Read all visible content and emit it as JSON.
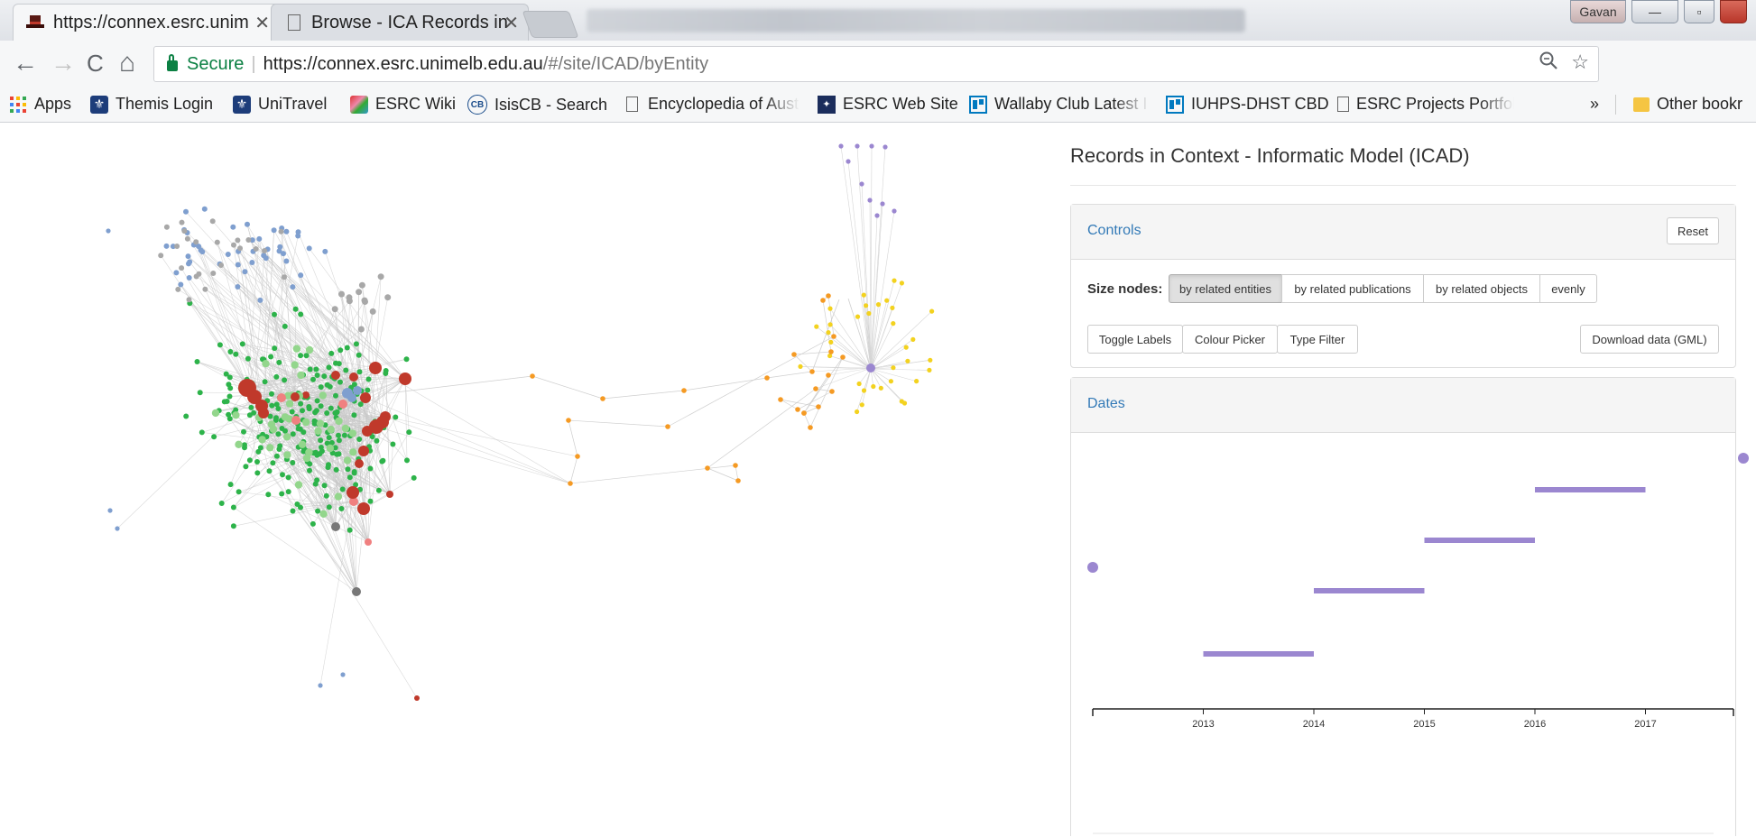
{
  "browser": {
    "tabs": [
      {
        "title": "https://connex.esrc.unim",
        "close": "✕",
        "active": true
      },
      {
        "title": "Browse - ICA Records in",
        "close": "✕",
        "active": false
      }
    ],
    "window": {
      "profile": "Gavan",
      "minimize": "—",
      "maximize": "▫",
      "close": "✕"
    },
    "nav": {
      "back": "←",
      "forward": "→",
      "reload": "C",
      "home": "⌂"
    },
    "omnibox": {
      "secure_label": "Secure",
      "separator": "|",
      "url_host": "https://connex.esrc.unimelb.edu.au",
      "url_path": "/#/site/ICAD/byEntity"
    },
    "bookmarks": [
      {
        "label": "Apps",
        "icon": "apps-grid-icon"
      },
      {
        "label": "Themis Login",
        "icon": "crest-icon"
      },
      {
        "label": "UniTravel",
        "icon": "crest-icon"
      },
      {
        "label": "ESRC Wiki",
        "icon": "wiki-icon"
      },
      {
        "label": "IsisCB - Search",
        "icon": "cb-icon"
      },
      {
        "label": "Encyclopedia of Aust",
        "icon": "page-icon"
      },
      {
        "label": "ESRC Web Site",
        "icon": "esrc-icon"
      },
      {
        "label": "Wallaby Club Latest I",
        "icon": "trello-icon"
      },
      {
        "label": "IUHPS-DHST CBD",
        "icon": "trello-icon"
      },
      {
        "label": "ESRC Projects Portfoli",
        "icon": "page-icon"
      }
    ],
    "bookmarks_overflow": "»",
    "other_bookmarks": "Other bookr"
  },
  "page": {
    "title": "Records in Context - Informatic Model (ICAD)",
    "controls": {
      "heading": "Controls",
      "reset": "Reset",
      "size_nodes_label": "Size nodes:",
      "size_options": [
        "by related entities",
        "by related publications",
        "by related objects",
        "evenly"
      ],
      "size_selected": "by related entities",
      "toggle_labels": "Toggle Labels",
      "colour_picker": "Colour Picker",
      "type_filter": "Type Filter",
      "download": "Download data (GML)"
    },
    "dates": {
      "heading": "Dates"
    }
  },
  "colors": {
    "entity_green": "#2db34a",
    "light_green": "#93d68c",
    "red": "#c0392b",
    "salmon": "#f08080",
    "blue": "#7f9fcf",
    "grey": "#a8a8a8",
    "orange": "#f59a23",
    "yellow": "#f3d21f",
    "purple": "#9b87d0",
    "link_blue": "#337ab7"
  },
  "chart_data": {
    "type": "timeline",
    "x_ticks": [
      "2013",
      "2014",
      "2015",
      "2016",
      "2017"
    ],
    "bars": [
      {
        "start": 2013.0,
        "end": 2014.0
      },
      {
        "start": 2014.0,
        "end": 2015.0
      },
      {
        "start": 2015.0,
        "end": 2016.0
      },
      {
        "start": 2016.0,
        "end": 2017.0
      }
    ],
    "points": [
      {
        "x": 2012.0
      }
    ],
    "color": "#9b87d0"
  }
}
